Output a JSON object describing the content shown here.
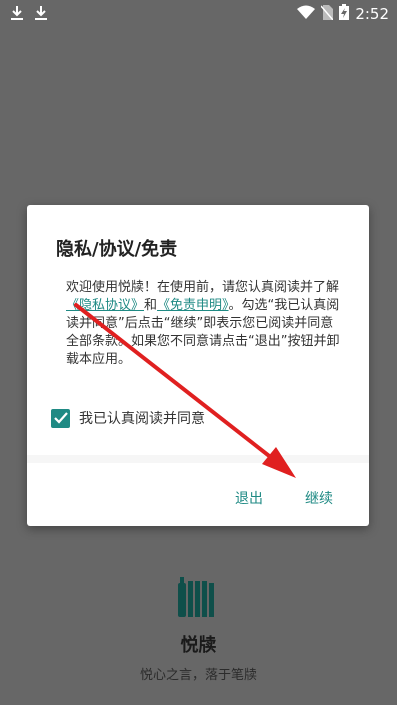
{
  "status_bar": {
    "time": "2:52",
    "left_icons": [
      "download-icon",
      "download-icon"
    ],
    "right_icons": [
      "wifi-icon",
      "no-sim-icon",
      "battery-charging-icon"
    ]
  },
  "splash": {
    "app_name": "悦牍",
    "slogan": "悦心之言，落于笔牍",
    "logo_icon": "book-stack-icon"
  },
  "dialog": {
    "title": "隐私/协议/免责",
    "body_part1": "欢迎使用悦牍！在使用前，请您认真阅读并了解",
    "privacy_link": "《隐私协议》",
    "body_and": "和",
    "disclaimer_link": "《免责申明》",
    "body_part2": "。勾选“我已认真阅读并同意”后点击“继续”即表示您已阅读并同意全部条款。如果您不同意请点击“退出”按钮并卸载本应用。",
    "checkbox_label": "我已认真阅读并同意",
    "checkbox_checked": true,
    "exit_button": "退出",
    "continue_button": "继续"
  },
  "colors": {
    "accent": "#1f8a84",
    "backdrop": "#676767",
    "annotation_arrow": "#e02020"
  }
}
